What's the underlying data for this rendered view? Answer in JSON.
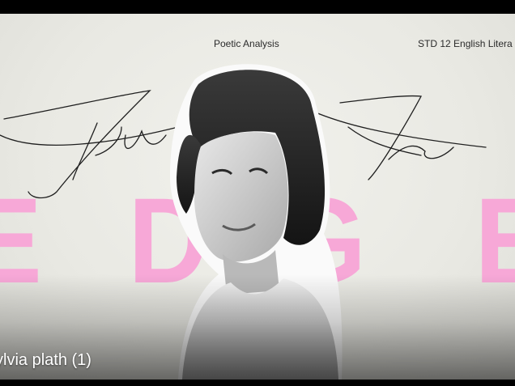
{
  "slide": {
    "header_left": "Poetic Analysis",
    "header_right": "STD 12 English Litera",
    "script_title_first": "Sylvia",
    "script_title_last": "Plath",
    "big_letters": [
      "E",
      "D",
      "G",
      "E"
    ],
    "accent_color": "#f7a8d7",
    "caption": "ylvia plath (1)"
  }
}
